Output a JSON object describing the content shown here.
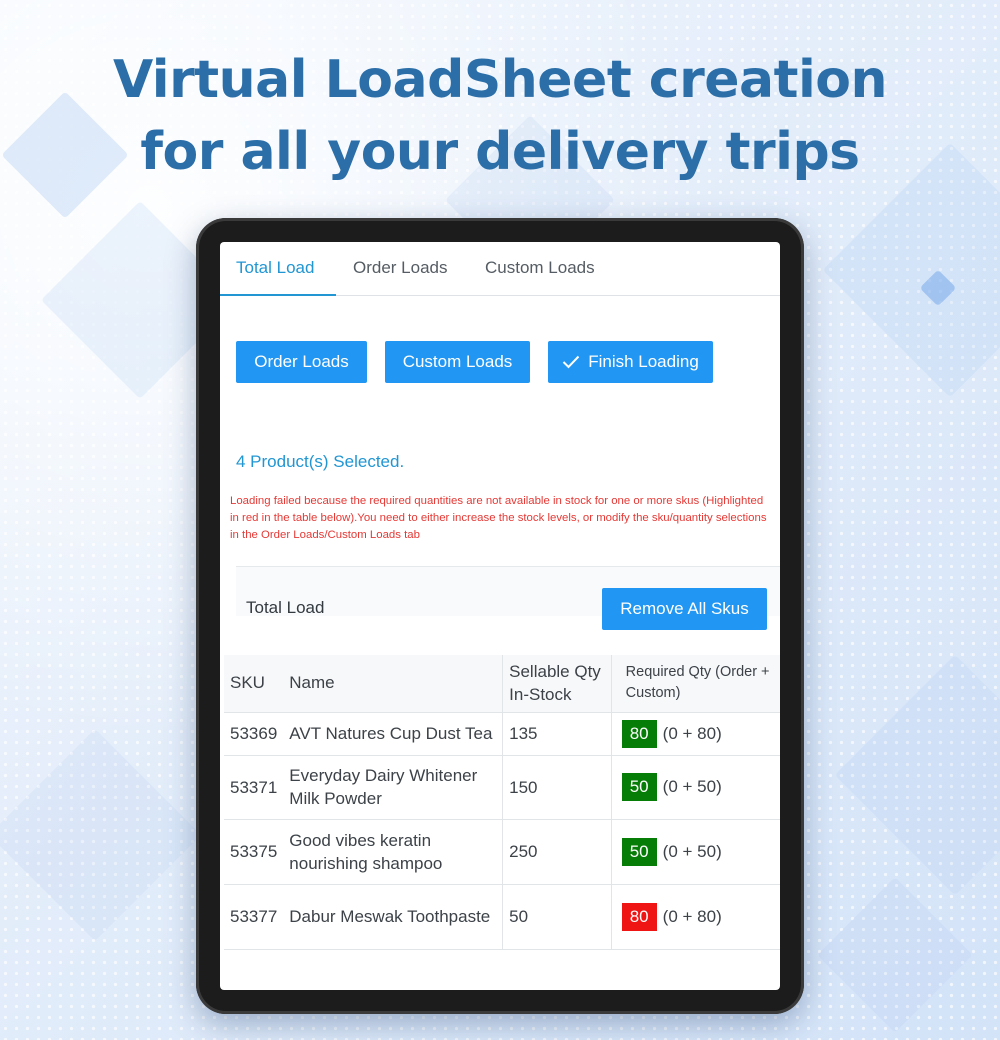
{
  "headline": {
    "line1": "Virtual LoadSheet creation",
    "line2": "for all your delivery trips"
  },
  "tabs": [
    {
      "label": "Total Load",
      "active": true
    },
    {
      "label": "Order Loads",
      "active": false
    },
    {
      "label": "Custom Loads",
      "active": false
    }
  ],
  "actions": {
    "order_loads": "Order Loads",
    "custom_loads": "Custom Loads",
    "finish_loading": "Finish Loading",
    "finish_icon": "check-icon"
  },
  "selected_count": "4 Product(s) Selected.",
  "error_message": "Loading failed because the required quantities are not available in stock for one or more skus (Highlighted in red in the table below).You need to either increase the stock levels, or modify the sku/quantity selections in the Order Loads/Custom Loads tab",
  "total_load": {
    "title": "Total Load",
    "remove_all": "Remove All Skus"
  },
  "table": {
    "headers": {
      "sku": "SKU",
      "name": "Name",
      "sellable": "Sellable Qty In-Stock",
      "required": "Required Qty (Order + Custom)"
    },
    "rows": [
      {
        "sku": "53369",
        "name": "AVT Natures Cup Dust Tea",
        "stock": "135",
        "required": "80",
        "breakdown": "(0 + 80)",
        "status": "ok"
      },
      {
        "sku": "53371",
        "name": "Everyday Dairy Whitener Milk Powder",
        "stock": "150",
        "required": "50",
        "breakdown": "(0 + 50)",
        "status": "ok"
      },
      {
        "sku": "53375",
        "name": "Good vibes keratin nourishing shampoo",
        "stock": "250",
        "required": "50",
        "breakdown": "(0 + 50)",
        "status": "ok"
      },
      {
        "sku": "53377",
        "name": "Dabur Meswak Toothpaste",
        "stock": "50",
        "required": "80",
        "breakdown": "(0 + 80)",
        "status": "insufficient"
      }
    ]
  },
  "colors": {
    "accent": "#2196f3",
    "headline": "#2b6ea8",
    "ok_badge": "#067d06",
    "error_badge": "#ef1515",
    "error_text": "#e53935"
  }
}
